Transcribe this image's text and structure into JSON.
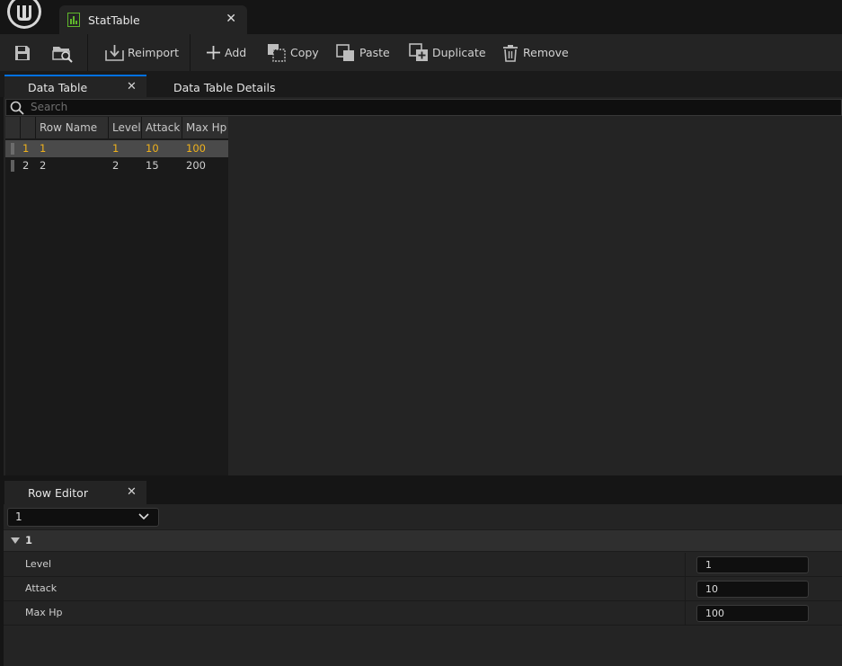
{
  "document_tab": {
    "title": "StatTable",
    "icon": "data-table-icon"
  },
  "toolbar": {
    "save_icon": "save-icon",
    "browse_icon": "browse-asset-icon",
    "reimport": "Reimport",
    "add": "Add",
    "copy": "Copy",
    "paste": "Paste",
    "duplicate": "Duplicate",
    "remove": "Remove"
  },
  "panel_tabs": {
    "data_table": "Data Table",
    "details": "Data Table Details"
  },
  "search": {
    "placeholder": "Search"
  },
  "table": {
    "columns": [
      "Row Name",
      "Level",
      "Attack",
      "Max Hp"
    ],
    "rows": [
      {
        "index": "1",
        "name": "1",
        "level": "1",
        "attack": "10",
        "max_hp": "100",
        "selected": true
      },
      {
        "index": "2",
        "name": "2",
        "level": "2",
        "attack": "15",
        "max_hp": "200",
        "selected": false
      }
    ]
  },
  "row_editor": {
    "tab": "Row Editor",
    "selected_row": "1",
    "category": "1",
    "properties": [
      {
        "label": "Level",
        "value": "1"
      },
      {
        "label": "Attack",
        "value": "10"
      },
      {
        "label": "Max Hp",
        "value": "100"
      }
    ]
  },
  "colors": {
    "accent": "#0070e0",
    "selection_text": "#f0b21c",
    "panel": "#242424",
    "input_bg": "#0f0f0f"
  }
}
